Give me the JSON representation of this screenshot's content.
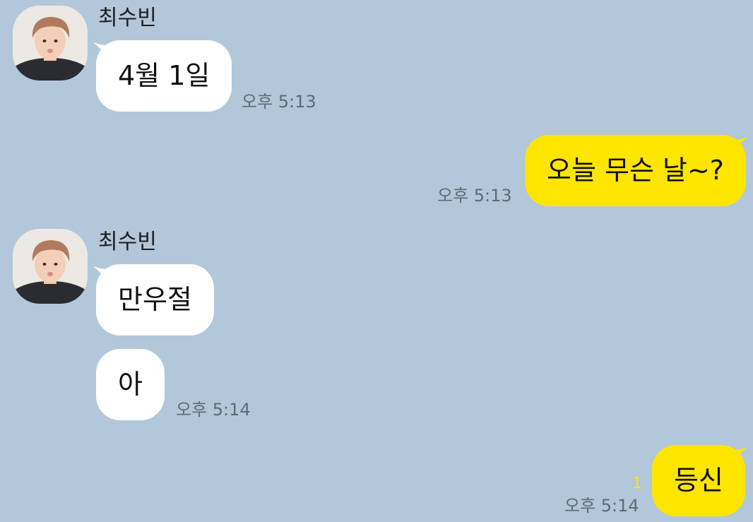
{
  "colors": {
    "background": "#b2c7d9",
    "incoming_bubble": "#ffffff",
    "outgoing_bubble": "#fee500",
    "time_text": "#606a74",
    "unread_count": "#ffe400"
  },
  "messages": [
    {
      "direction": "in",
      "sender": "최수빈",
      "text": "4월 1일",
      "time": "오후 5:13"
    },
    {
      "direction": "out",
      "text": "오늘 무슨 날~?",
      "time": "오후 5:13"
    },
    {
      "direction": "in",
      "sender": "최수빈",
      "text": "만우절"
    },
    {
      "direction": "in",
      "text": "아",
      "time": "오후 5:14"
    },
    {
      "direction": "out",
      "text": "등신",
      "time": "오후 5:14",
      "unread": "1"
    }
  ]
}
